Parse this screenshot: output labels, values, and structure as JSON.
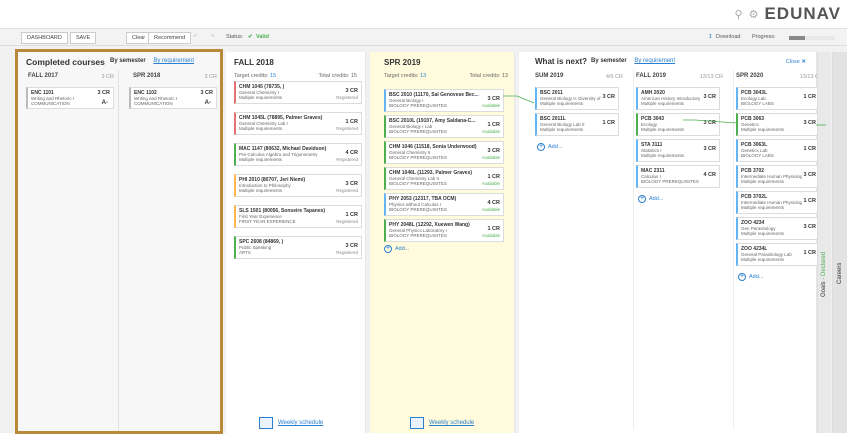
{
  "brand": {
    "logo": "EDUNAV",
    "icons": [
      "search-icon",
      "gear-icon"
    ]
  },
  "toolbar": {
    "dashboard": "DASHBOARD",
    "save": "SAVE",
    "clear": "Clear",
    "recommend": "Recommend",
    "status_label": "Status:",
    "status_value": "Valid",
    "download": "Download",
    "progress_label": "Progress:",
    "progress": 0.35
  },
  "completed": {
    "title": "Completed courses",
    "tab_semester": "By semester",
    "tab_requirement": "By requirement",
    "sem1": {
      "name": "FALL 2017",
      "cr": "3 CR",
      "course": {
        "code": "ENC 1101",
        "title": "Writing and Rhetoric I",
        "req": "COMMUNICATION",
        "cr": "3 CR",
        "grade": "A-"
      }
    },
    "sem2": {
      "name": "SPR 2018",
      "cr": "3 CR",
      "course": {
        "code": "ENC 1102",
        "title": "Writing and Rhetoric I",
        "req": "COMMUNICATION",
        "cr": "3 CR",
        "grade": "A-"
      }
    }
  },
  "fall2018": {
    "title": "FALL 2018",
    "target_label": "Target credits:",
    "target": "15",
    "total_label": "Total credits:",
    "total": "15",
    "weekly": "Weekly schedule",
    "courses": [
      {
        "code": "CHM 1045 (78735, )",
        "title": "General Chemistry I",
        "req": "Multiple requirements",
        "cr": "3 CR",
        "status": "Registered"
      },
      {
        "code": "CHM 1045L (78895, Palmer Graves)",
        "title": "General Chemistry Lab I",
        "req": "Multiple requirements",
        "cr": "1 CR",
        "status": "Registered"
      },
      {
        "code": "MAC 1147 (80632, Michael Davidson)",
        "title": "Pre-Calculus Algebra and Trigonometry",
        "req": "Multiple requirements",
        "cr": "4 CR",
        "status": "Registered"
      },
      {
        "code": "PHI 2010 (80707, Jeri Niemi)",
        "title": "Introduction to Philosophy",
        "req": "Multiple requirements",
        "cr": "3 CR",
        "status": "Registered"
      },
      {
        "code": "SLS 1501 (80056, Sonseire Tapanes)",
        "title": "First Year Experience",
        "req": "FIRST YEAR EXPERIENCE",
        "cr": "1 CR",
        "status": "Registered"
      },
      {
        "code": "SPC 2608 (84869, )",
        "title": "Public Speaking",
        "req": "ARTS",
        "cr": "3 CR",
        "status": "Registered"
      }
    ]
  },
  "spr2019": {
    "title": "SPR 2019",
    "target_label": "Target credits:",
    "target": "13",
    "total_label": "Total credits:",
    "total": "13",
    "weekly": "Weekly schedule",
    "add": "Add...",
    "courses": [
      {
        "code": "BSC 2010 (11170, Sal Genovese Bec...",
        "title": "General Biology I",
        "req": "BIOLOGY PREREQUISITES",
        "cr": "3 CR",
        "status": "Available"
      },
      {
        "code": "BSC 2010L (19107, Amy Saldana-C...",
        "title": "General Biology I Lab",
        "req": "BIOLOGY PREREQUISITES",
        "cr": "1 CR",
        "status": "Available"
      },
      {
        "code": "CHM 1046 (11518, Sonia Underwood)",
        "title": "General Chemistry II",
        "req": "BIOLOGY PREREQUISITES",
        "cr": "3 CR",
        "status": "Available"
      },
      {
        "code": "CHM 1046L (11293, Palmer Graves)",
        "title": "General Chemistry Lab II",
        "req": "BIOLOGY PREREQUISITES",
        "cr": "1 CR",
        "status": "Available"
      },
      {
        "code": "PHY 2053 (12317, TBA OCM)",
        "title": "Physics without Calculus I",
        "req": "BIOLOGY PREREQUISITES",
        "cr": "4 CR",
        "status": "Available"
      },
      {
        "code": "PHY 2048L (12292, Xuewen Wang)",
        "title": "General Physics Laboratory I",
        "req": "BIOLOGY PREREQUISITES",
        "cr": "1 CR",
        "status": "Available"
      }
    ]
  },
  "next": {
    "title": "What is next?",
    "tab_semester": "By semester",
    "tab_requirement": "By requirement",
    "close": "Close",
    "add": "Add...",
    "sum2019": {
      "name": "SUM 2019",
      "cr": "4/6 CR",
      "courses": [
        {
          "code": "BSC 2011",
          "title": "General Biology II: Diversity of L...",
          "req": "Multiple requirements",
          "cr": "3 CR"
        },
        {
          "code": "BSC 2011L",
          "title": "General Biology Lab II",
          "req": "Multiple requirements",
          "cr": "1 CR"
        }
      ]
    },
    "fall2019": {
      "name": "FALL 2019",
      "cr": "13/13 CR",
      "courses": [
        {
          "code": "AMH 2020",
          "title": "American History Introductory ...",
          "req": "Multiple requirements",
          "cr": "3 CR"
        },
        {
          "code": "PCB 3043",
          "title": "Ecology",
          "req": "Multiple requirements",
          "cr": "3 CR"
        },
        {
          "code": "STA 3111",
          "title": "Statistics I",
          "req": "Multiple requirements",
          "cr": "3 CR"
        },
        {
          "code": "MAC 2311",
          "title": "Calculus I",
          "req": "BIOLOGY PREREQUISITES",
          "cr": "4 CR"
        }
      ]
    },
    "spr2020": {
      "name": "SPR 2020",
      "cr": "13/13 CR",
      "courses": [
        {
          "code": "PCB 3043L",
          "title": "Ecology Lab",
          "req": "BIOLOGY LABS",
          "cr": "1 CR"
        },
        {
          "code": "PCB 3063",
          "title": "Genetics",
          "req": "Multiple requirements",
          "cr": "3 CR"
        },
        {
          "code": "PCB 3063L",
          "title": "Genetics Lab",
          "req": "BIOLOGY LABS",
          "cr": "1 CR"
        },
        {
          "code": "PCB 3702",
          "title": "Intermediate Human Physiology",
          "req": "Multiple requirements",
          "cr": "3 CR"
        },
        {
          "code": "PCB 3702L",
          "title": "Intermediate Human Physiolog...",
          "req": "Multiple requirements",
          "cr": "1 CR"
        },
        {
          "code": "ZOO 4234",
          "title": "Gen Parasitology",
          "req": "Multiple requirements",
          "cr": "3 CR"
        },
        {
          "code": "ZOO 4234L",
          "title": "General Parasitology Lab",
          "req": "Multiple requirements",
          "cr": "1 CR"
        }
      ]
    }
  },
  "side": {
    "goals": "Goals",
    "declared": "Declared",
    "careers": "Careers"
  }
}
